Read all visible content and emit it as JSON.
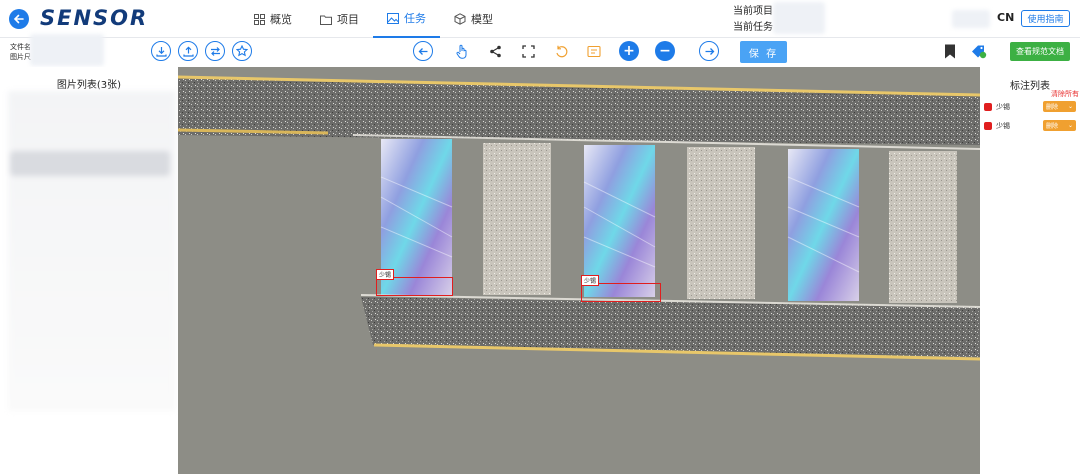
{
  "header": {
    "logo_text": "SENSOR",
    "nav": [
      {
        "label": "概览",
        "icon": "grid-icon"
      },
      {
        "label": "项目",
        "icon": "folder-icon"
      },
      {
        "label": "任务",
        "icon": "image-icon",
        "active": true
      },
      {
        "label": "模型",
        "icon": "cube-icon"
      }
    ],
    "current_project_label": "当前项目",
    "current_task_label": "当前任务",
    "language": "CN",
    "guide_button": "使用指南"
  },
  "toolbar": {
    "file_name_label": "文件名",
    "image_label": "图片尺",
    "save_label": "保 存",
    "doc_button": "查看规范文档",
    "zoom_in": "+",
    "zoom_out": "−"
  },
  "left_panel": {
    "title": "图片列表(3张)"
  },
  "canvas": {
    "boxes": [
      {
        "label": "少锡"
      },
      {
        "label": "少锡"
      }
    ]
  },
  "right_panel": {
    "title": "标注列表",
    "clear_all": "清除所有",
    "annotations": [
      {
        "label": "少锡",
        "action": "删除"
      },
      {
        "label": "少锡",
        "action": "删除"
      }
    ]
  },
  "colors": {
    "accent": "#1e7be8",
    "annotation_red": "#e01e1e",
    "doc_green": "#3cb043",
    "select_orange": "#f0a030"
  }
}
